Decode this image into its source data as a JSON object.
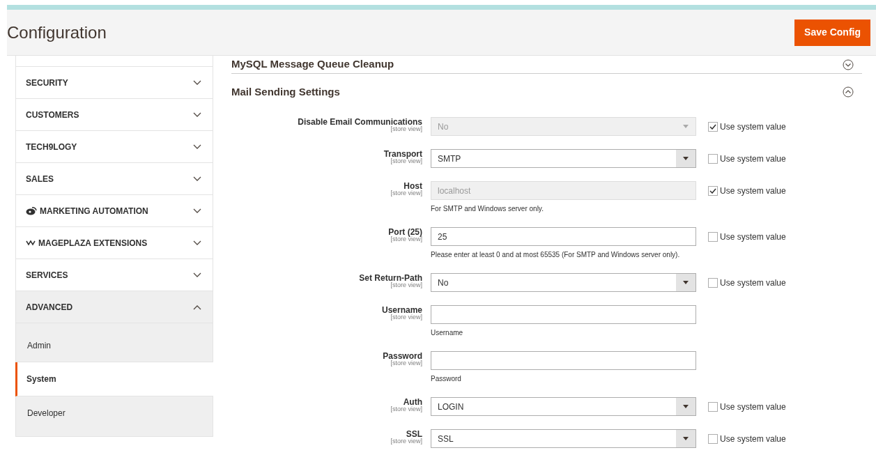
{
  "header": {
    "title": "Configuration",
    "save_button": "Save Config"
  },
  "sidebar": {
    "items": [
      {
        "label": "SECURITY",
        "expanded": false
      },
      {
        "label": "CUSTOMERS",
        "expanded": false
      },
      {
        "label": "TECH9LOGY",
        "expanded": false
      },
      {
        "label": "SALES",
        "expanded": false
      },
      {
        "label": "MARKETING AUTOMATION",
        "expanded": false
      },
      {
        "label": "MAGEPLAZA EXTENSIONS",
        "expanded": false
      },
      {
        "label": "SERVICES",
        "expanded": false
      },
      {
        "label": "ADVANCED",
        "expanded": true,
        "children": [
          {
            "label": "Admin",
            "selected": false
          },
          {
            "label": "System",
            "selected": true
          },
          {
            "label": "Developer",
            "selected": false
          }
        ]
      }
    ]
  },
  "sections": [
    {
      "title": "MySQL Message Queue Cleanup",
      "expanded": false
    },
    {
      "title": "Mail Sending Settings",
      "expanded": true
    }
  ],
  "fields": [
    {
      "label": "Disable Email Communications",
      "scope": "[store view]",
      "kind": "select",
      "value": "No",
      "disabled": true,
      "use_system_value": true,
      "use_system_label": "Use system value"
    },
    {
      "label": "Transport",
      "scope": "[store view]",
      "kind": "select",
      "value": "SMTP",
      "disabled": false,
      "use_system_value": false,
      "use_system_label": "Use system value"
    },
    {
      "label": "Host",
      "scope": "[store view]",
      "kind": "text",
      "value": "localhost",
      "disabled": true,
      "note": "For SMTP and Windows server only.",
      "use_system_value": true,
      "use_system_label": "Use system value"
    },
    {
      "label": "Port (25)",
      "scope": "[store view]",
      "kind": "text",
      "value": "25",
      "disabled": false,
      "note": "Please enter at least 0 and at most 65535 (For SMTP and Windows server only).",
      "use_system_value": false,
      "use_system_label": "Use system value"
    },
    {
      "label": "Set Return-Path",
      "scope": "[store view]",
      "kind": "select",
      "value": "No",
      "disabled": false,
      "use_system_value": false,
      "use_system_label": "Use system value"
    },
    {
      "label": "Username",
      "scope": "[store view]",
      "kind": "text",
      "disabled": false,
      "note": "Username"
    },
    {
      "label": "Password",
      "scope": "[store view]",
      "kind": "text",
      "disabled": false,
      "note": "Password"
    },
    {
      "label": "Auth",
      "scope": "[store view]",
      "kind": "select",
      "value": "LOGIN",
      "disabled": false,
      "use_system_value": false,
      "use_system_label": "Use system value"
    },
    {
      "label": "SSL",
      "scope": "[store view]",
      "kind": "select",
      "value": "SSL",
      "disabled": false,
      "use_system_value": false,
      "use_system_label": "Use system value"
    }
  ]
}
